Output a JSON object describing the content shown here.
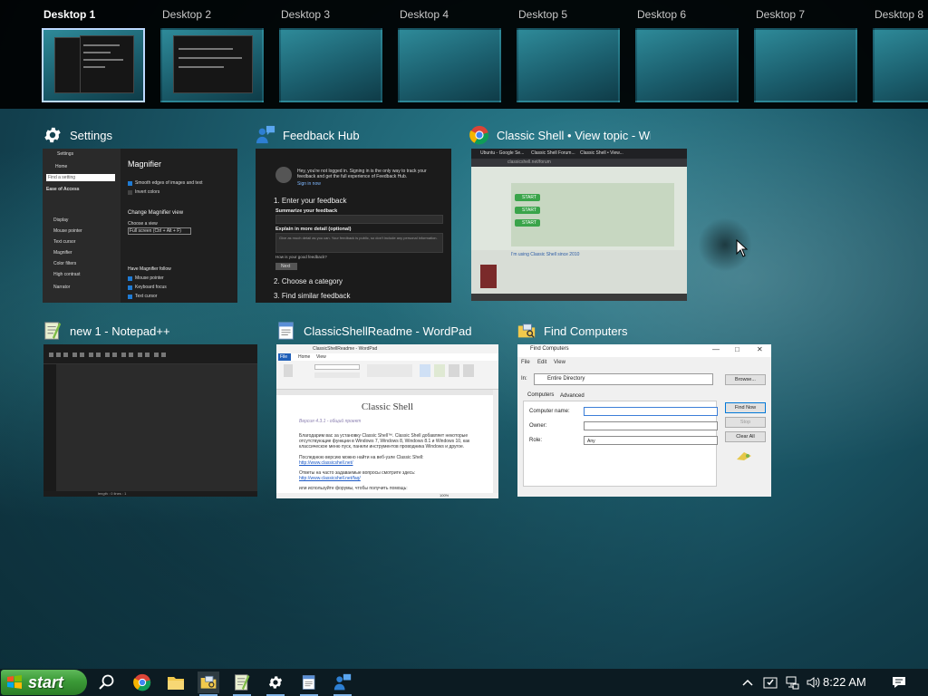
{
  "desktops": [
    {
      "label": "Desktop 1",
      "active": true
    },
    {
      "label": "Desktop 2",
      "active": false
    },
    {
      "label": "Desktop 3",
      "active": false
    },
    {
      "label": "Desktop 4",
      "active": false
    },
    {
      "label": "Desktop 5",
      "active": false
    },
    {
      "label": "Desktop 6",
      "active": false
    },
    {
      "label": "Desktop 7",
      "active": false
    },
    {
      "label": "Desktop 8",
      "active": false
    }
  ],
  "windows": {
    "settings": {
      "title": "Settings",
      "icon": "gear-icon",
      "content": {
        "header": "Settings",
        "home": "Home",
        "find": "Find a setting",
        "section": "Ease of Access",
        "nav": [
          "Display",
          "Mouse pointer",
          "Text cursor",
          "Magnifier",
          "Color filters",
          "High contrast",
          "Narrator"
        ],
        "page_title": "Magnifier",
        "options": [
          "Smooth edges of images and text",
          "Invert colors"
        ],
        "view_heading": "Change Magnifier view",
        "choose_view": "Choose a view",
        "view_value": "Full screen (Ctrl + Alt + F)",
        "follow_heading": "Have Magnifier follow",
        "follow_options": [
          "Mouse pointer",
          "Keyboard focus",
          "Text cursor"
        ]
      }
    },
    "feedback": {
      "title": "Feedback Hub",
      "icon": "feedback-hub-icon",
      "content": {
        "signin": "Hey, you're not logged in. Signing in is the only way to track your feedback and get the full experience of Feedback Hub.",
        "signin_link": "Sign in now",
        "step1": "1. Enter your feedback",
        "summarize": "Summarize your feedback",
        "explain": "Explain in more detail (optional)",
        "explain_hint": "Give as much detail as you can. Your feedback is public, so don't include any personal information.",
        "good": "How is your good feedback?",
        "next": "Next",
        "step2": "2. Choose a category",
        "step3": "3. Find similar feedback"
      }
    },
    "chrome": {
      "title": "Classic Shell • View topic - Wi...",
      "icon": "chrome-icon",
      "content": {
        "tabs": [
          "Ubuntu - Google Se...",
          "Classic Shell Forum...",
          "Classic Shell • View..."
        ],
        "url": "classicshell.net/forum",
        "buttons": [
          "START",
          "START",
          "START"
        ],
        "link": "I'm using Classic Shell since 2010"
      }
    },
    "notepadpp": {
      "title": "new 1 - Notepad++",
      "icon": "notepadpp-icon",
      "content": {
        "status": "length : 0    lines : 1"
      }
    },
    "wordpad": {
      "title": "ClassicShellReadme - WordPad",
      "icon": "wordpad-icon",
      "content": {
        "window_title": "ClassicShellReadme - WordPad",
        "tabs": [
          "File",
          "Home",
          "View"
        ],
        "doc_title": "Classic Shell",
        "version": "Версия 4.3.1 - общий проект",
        "para1_line1": "Благодарим вас за установку Classic Shell™. Classic Shell добавляет некоторые",
        "para1_line2": "отсутствующие функции в Windows 7, Windows 8, Windows 8.1 и Windows 10, как",
        "para1_line3": "классическое меню пуск, панели инструментов проводника Windows и другое.",
        "para2": "Последнюю версию можно найти на веб-узле Classic Shell:",
        "link1": "http://www.classicshell.net/",
        "para3": "Ответы на часто задаваемые вопросы смотрите здесь:",
        "link2": "http://www.classicshell.net/faq/",
        "para4": "или используйте форумы, чтобы получить помощь:",
        "zoom": "100%"
      }
    },
    "findcomputers": {
      "title": "Find Computers",
      "icon": "find-computers-icon",
      "content": {
        "window_title": "Find Computers",
        "menu": [
          "File",
          "Edit",
          "View"
        ],
        "in": "In:",
        "combo_value": "Entire Directory",
        "browse": "Browse...",
        "tabs": [
          "Computers",
          "Advanced"
        ],
        "labels": [
          "Computer name:",
          "Owner:",
          "Role:"
        ],
        "role_value": "Any",
        "buttons": [
          "Find Now",
          "Stop",
          "Clear All"
        ]
      }
    }
  },
  "taskbar": {
    "start_label": "start",
    "pinned": [
      "search-icon",
      "chrome-icon",
      "file-explorer-icon",
      "find-computers-icon",
      "notepadpp-icon",
      "settings-icon",
      "wordpad-icon",
      "feedback-hub-icon"
    ],
    "tray": [
      "show-hidden-icons-chevron",
      "security-icon",
      "network-icon",
      "volume-icon"
    ],
    "clock": "8:22 AM",
    "notifications": "action-center-icon"
  },
  "colors": {
    "taskbar_bg": "#0c1b22",
    "start_green": "#3b9a37",
    "active_desktop_border": "#bcd9ff",
    "accent_blue": "#1f7bd4"
  }
}
